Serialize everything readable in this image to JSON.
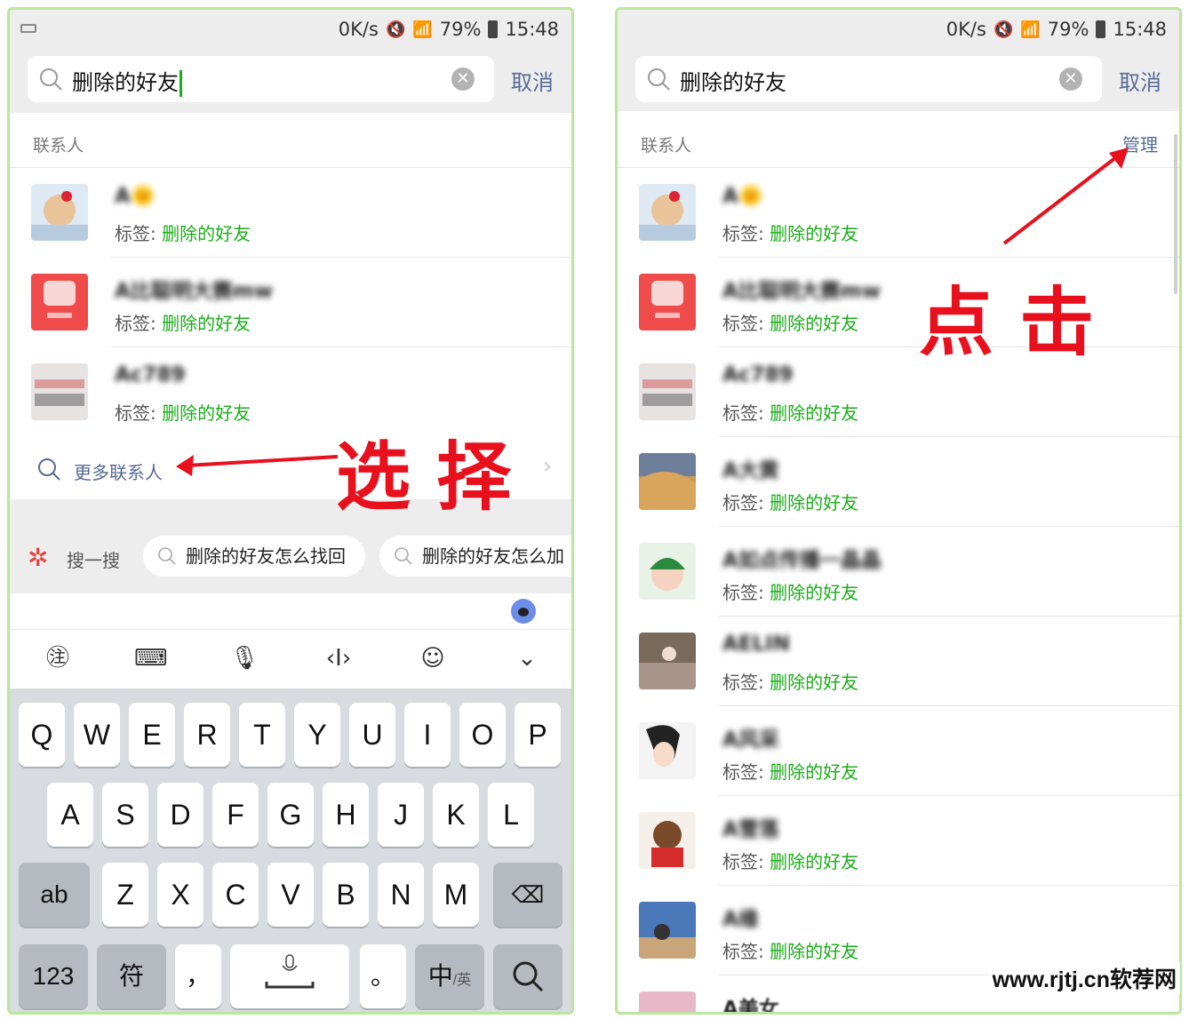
{
  "status": {
    "speed": "0K/s",
    "battery": "79%",
    "time": "15:48"
  },
  "search": {
    "query": "删除的好友",
    "cancel": "取消",
    "clear_icon": "clear-icon"
  },
  "section": {
    "title": "联系人",
    "manage": "管理"
  },
  "contacts": [
    {
      "name": "A🌞",
      "tag_label": "标签:",
      "tag": "删除的好友",
      "color": "#dfe9f3"
    },
    {
      "name": "A比聪明大赛mw",
      "tag_label": "标签:",
      "tag": "删除的好友",
      "color": "#f04b4b"
    },
    {
      "name": "Ac789",
      "tag_label": "标签:",
      "tag": "删除的好友",
      "color": "#e7e3e3"
    },
    {
      "name": "A大黄",
      "tag_label": "标签:",
      "tag": "删除的好友",
      "color": "#c79a5a"
    },
    {
      "name": "A如点传播一晶晶",
      "tag_label": "标签:",
      "tag": "删除的好友",
      "color": "#e9f2e6"
    },
    {
      "name": "AELIN",
      "tag_label": "标签:",
      "tag": "删除的好友",
      "color": "#7a6a5c"
    },
    {
      "name": "A风采",
      "tag_label": "标签:",
      "tag": "删除的好友",
      "color": "#f3f3f3"
    },
    {
      "name": "A雪落",
      "tag_label": "标签:",
      "tag": "删除的好友",
      "color": "#f5efe9"
    },
    {
      "name": "A缘",
      "tag_label": "标签:",
      "tag": "删除的好友",
      "color": "#4a78b8"
    },
    {
      "name": "A美女",
      "tag_label": "",
      "tag": "",
      "color": "#e8b8c8"
    }
  ],
  "more": {
    "label": "更多联系人"
  },
  "sougou": {
    "label": "搜一搜",
    "chips": [
      "删除的好友怎么找回",
      "删除的好友怎么加"
    ]
  },
  "keyboard": {
    "row1": [
      "Q",
      "W",
      "E",
      "R",
      "T",
      "Y",
      "U",
      "I",
      "O",
      "P"
    ],
    "row2": [
      "A",
      "S",
      "D",
      "F",
      "G",
      "H",
      "J",
      "K",
      "L"
    ],
    "row3": [
      "Z",
      "X",
      "C",
      "V",
      "B",
      "N",
      "M"
    ],
    "shift": "ab",
    "num": "123",
    "sym": "符",
    "comma": "，",
    "period": "。",
    "lang": "中/英",
    "lang_main": "中",
    "lang_sub": "/英"
  },
  "annotations": {
    "left": "选 择",
    "right": "点 击"
  },
  "watermark": "www.rjtj.cn软荐网"
}
